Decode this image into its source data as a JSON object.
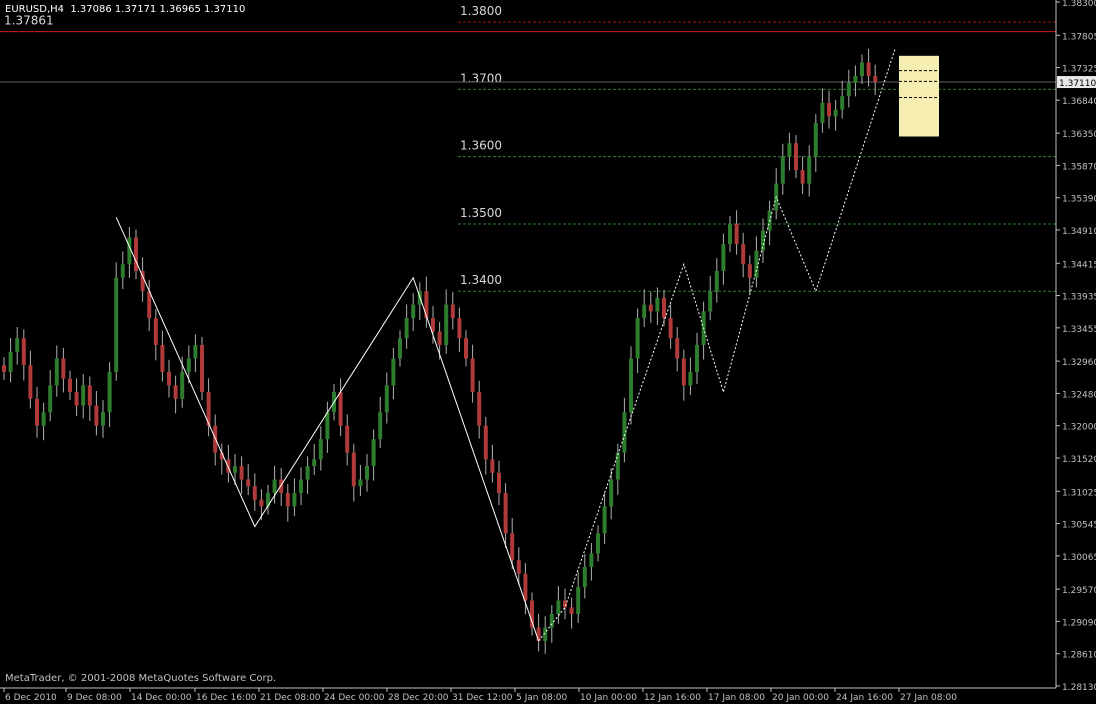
{
  "header": {
    "symbol": "EURUSD,H4",
    "open": "1.37086",
    "high": "1.37171",
    "low": "1.36965",
    "close": "1.37110"
  },
  "copyright": "MetaTrader, © 2001-2008 MetaQuotes Software Corp.",
  "colors": {
    "background": "#000000",
    "bull": "#2e7d2e",
    "bear": "#b03a3a",
    "wick": "#b0b0b0",
    "level_line": "#2e7d2e",
    "red_level": "#c82020",
    "axis_text": "#c0c0c0",
    "zigzag": "#ffffff",
    "projection_box": "#f5eeb0"
  },
  "chart_data": {
    "type": "candlestick",
    "title": "",
    "ylim": [
      1.281,
      1.383
    ],
    "y_ticks": [
      "1.38300",
      "1.37805",
      "1.37325",
      "1.36840",
      "1.36350",
      "1.35870",
      "1.35390",
      "1.34910",
      "1.34415",
      "1.33935",
      "1.33455",
      "1.32960",
      "1.32480",
      "1.32000",
      "1.31520",
      "1.31025",
      "1.30545",
      "1.30065",
      "1.29570",
      "1.29090",
      "1.28610",
      "1.28130"
    ],
    "x_ticks": [
      "6 Dec 2010",
      "9 Dec 08:00",
      "14 Dec 00:00",
      "16 Dec 16:00",
      "21 Dec 08:00",
      "24 Dec 00:00",
      "28 Dec 20:00",
      "31 Dec 12:00",
      "5 Jan 08:00",
      "10 Jan 00:00",
      "12 Jan 16:00",
      "17 Jan 08:00",
      "20 Jan 00:00",
      "24 Jan 16:00",
      "27 Jan 08:00"
    ],
    "current_price": "1.37110",
    "red_level": {
      "label": "1.37861",
      "value": 1.3786
    },
    "levels": [
      {
        "label": "1.3800",
        "value": 1.38,
        "color": "red"
      },
      {
        "label": "1.3700",
        "value": 1.37,
        "color": "green"
      },
      {
        "label": "1.3600",
        "value": 1.36,
        "color": "green"
      },
      {
        "label": "1.3500",
        "value": 1.35,
        "color": "green"
      },
      {
        "label": "1.3400",
        "value": 1.34,
        "color": "green"
      }
    ],
    "closes": [
      1.328,
      1.331,
      1.333,
      1.329,
      1.324,
      1.32,
      1.322,
      1.326,
      1.33,
      1.327,
      1.325,
      1.323,
      1.326,
      1.323,
      1.32,
      1.322,
      1.328,
      1.342,
      1.344,
      1.348,
      1.343,
      1.34,
      1.336,
      1.332,
      1.328,
      1.326,
      1.324,
      1.328,
      1.33,
      1.332,
      1.325,
      1.32,
      1.316,
      1.315,
      1.313,
      1.314,
      1.312,
      1.311,
      1.309,
      1.308,
      1.31,
      1.312,
      1.31,
      1.308,
      1.31,
      1.312,
      1.314,
      1.315,
      1.318,
      1.322,
      1.325,
      1.32,
      1.316,
      1.311,
      1.312,
      1.314,
      1.318,
      1.322,
      1.326,
      1.33,
      1.333,
      1.336,
      1.338,
      1.34,
      1.336,
      1.334,
      1.332,
      1.338,
      1.336,
      1.333,
      1.33,
      1.325,
      1.32,
      1.315,
      1.313,
      1.31,
      1.304,
      1.3,
      1.298,
      1.294,
      1.29,
      1.288,
      1.29,
      1.292,
      1.294,
      1.293,
      1.292,
      1.296,
      1.299,
      1.301,
      1.304,
      1.308,
      1.312,
      1.316,
      1.322,
      1.33,
      1.336,
      1.338,
      1.337,
      1.339,
      1.336,
      1.333,
      1.33,
      1.326,
      1.328,
      1.332,
      1.337,
      1.34,
      1.343,
      1.347,
      1.35,
      1.347,
      1.344,
      1.342,
      1.346,
      1.349,
      1.352,
      1.356,
      1.36,
      1.362,
      1.358,
      1.356,
      1.36,
      1.365,
      1.368,
      1.366,
      1.367,
      1.369,
      1.371,
      1.372,
      1.374,
      1.372,
      1.3711
    ],
    "zigzag_solid": [
      [
        17,
        1.351
      ],
      [
        38,
        1.305
      ],
      [
        62,
        1.342
      ],
      [
        81,
        1.288
      ]
    ],
    "zigzag_dotted": [
      [
        81,
        1.288
      ],
      [
        85,
        1.293
      ],
      [
        103,
        1.344
      ],
      [
        109,
        1.325
      ],
      [
        117,
        1.354
      ],
      [
        123,
        1.34
      ],
      [
        135,
        1.376
      ]
    ],
    "projection_box": {
      "high": 1.375,
      "low": 1.363
    }
  }
}
